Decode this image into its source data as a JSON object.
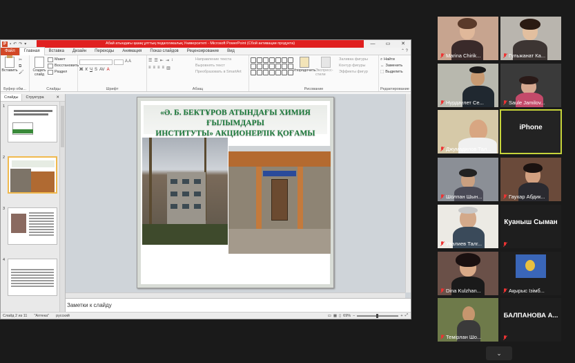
{
  "powerpoint": {
    "window_title": "Абай атындағы қазақ ұлттық педагогикалық Университеті - Microsoft PowerPoint (Сбой активации продукта)",
    "quick_access": [
      "↶",
      "↷",
      "▾"
    ],
    "window_controls": [
      "—",
      "▭",
      "✕"
    ],
    "tabs": [
      "Файл",
      "Главная",
      "Вставка",
      "Дизайн",
      "Переходы",
      "Анимация",
      "Показ слайдов",
      "Рецензирование",
      "Вид"
    ],
    "ribbon": {
      "clipboard": {
        "paste": "Вставить",
        "cut": "✂",
        "copy": "⧉",
        "format": "🖌",
        "label": "Буфер обм..."
      },
      "slides": {
        "new_slide": "Создать слайд",
        "layout": "Макет",
        "reset": "Восстановить",
        "section": "Раздел",
        "label": "Слайды"
      },
      "font": {
        "label": "Шрифт"
      },
      "paragraph": {
        "text_direction": "Направление текста",
        "align_text": "Выровнять текст",
        "smartart": "Преобразовать в SmartArt",
        "label": "Абзац"
      },
      "drawing": {
        "arrange": "Упорядочить",
        "quick_styles": "Экспресс-стили",
        "shape_fill": "Заливка фигуры",
        "shape_outline": "Контур фигуры",
        "shape_effects": "Эффекты фигур",
        "label": "Рисование"
      },
      "editing": {
        "find": "Найти",
        "replace": "Заменить",
        "select": "Выделить",
        "label": "Редактирование"
      }
    },
    "panel_tabs": {
      "slides": "Слайды",
      "outline": "Структура",
      "close": "✕"
    },
    "thumbnail_numbers": [
      "1",
      "2",
      "3",
      "4"
    ],
    "slide": {
      "title_line1": "«Ә. Б. БЕКТҰРОВ АТЫНДАҒЫ ХИМИЯ ҒЫЛЫМДАРЫ",
      "title_line2": "ИНСТИТУТЫ» АКЦИОНЕРЛІК ҚОҒАМЫ"
    },
    "notes_placeholder": "Заметки к слайду",
    "status": {
      "slide": "Слайд 2 из 11",
      "theme": "\"Аптека\"",
      "language": "русский",
      "zoom": "69%"
    }
  },
  "participants": [
    {
      "name": "Marina Chirik...",
      "muted": true
    },
    {
      "name": "Гульжанат Ка...",
      "muted": true
    },
    {
      "name": "Нурдаулет Се...",
      "muted": true
    },
    {
      "name": "Saule Jamilov...",
      "muted": true
    },
    {
      "name": "Джумадилов Тал...",
      "muted": true
    },
    {
      "name": "iPhone",
      "muted": false,
      "video": false
    },
    {
      "name": "Шолпан Шын...",
      "muted": true
    },
    {
      "name": "Гаухар Абдик...",
      "muted": true
    },
    {
      "name": "Увалиев Талг...",
      "muted": true
    },
    {
      "name": "Куаныш Сыман",
      "muted": true,
      "video": false
    },
    {
      "name": "Dina Kulzhan...",
      "muted": true
    },
    {
      "name": "Ақырыс Ізімб...",
      "muted": true
    },
    {
      "name": "Темірлан Шо...",
      "muted": true
    },
    {
      "name": "БАЛПАНОВА А...",
      "muted": true,
      "video": false
    }
  ],
  "gallery_next": "⌄",
  "colors": {
    "file_tab": "#d24726",
    "title_red": "#e02020",
    "slide_title_green": "#1c7a3b",
    "speaking_border": "#c7d43a"
  }
}
